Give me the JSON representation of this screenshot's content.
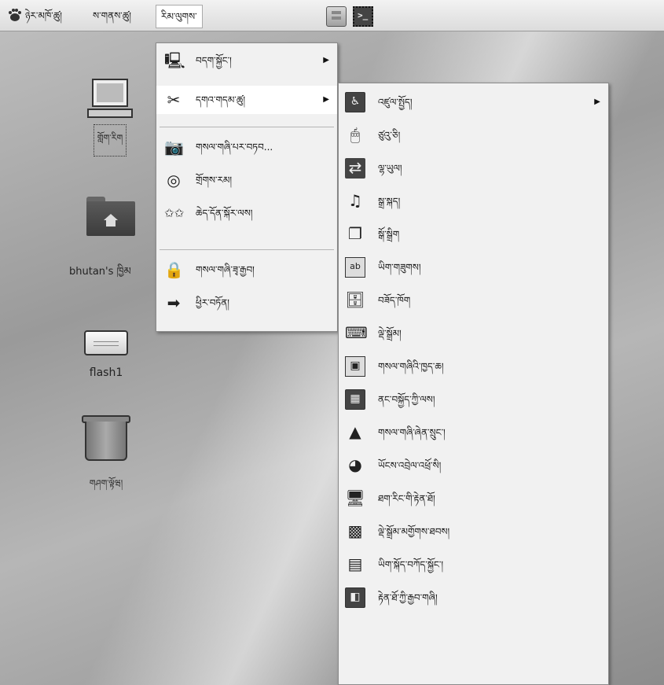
{
  "panel": {
    "applications": "ཉེར་མཁོ་ཚུ།",
    "places": "ས་གནས་ཚུ།",
    "system": "རིམ་ལུགས་",
    "icons": {
      "logo": "gnome-foot-icon",
      "files": "filing-cabinet-icon",
      "terminal": "terminal-icon"
    },
    "terminal_glyph": ">_"
  },
  "desktop": {
    "computer_label": "གློག་རིག",
    "home_label": "bhutan's ཁྱིམ",
    "flash_label": "flash1",
    "trash_label": "གཤག་ལྟོཝ།"
  },
  "system_menu": {
    "items": [
      {
        "label": "བདག་སྐྱོང་།",
        "icon": "computer-icon",
        "has_submenu": true
      },
      {
        "label": "དགའ་གདམ་ཚུ།",
        "icon": "tools-icon",
        "has_submenu": true
      },
      {
        "label": "གསལ་གཞི་པར་བཏབ...",
        "icon": "camera-icon",
        "has_submenu": false
      },
      {
        "label": "གྲོགས་རམ།",
        "icon": "help-icon",
        "has_submenu": false
      },
      {
        "label": "ཆེད་དོན་སྐོར་ལས།",
        "icon": "about-icon",
        "has_submenu": false
      },
      {
        "label": "གསལ་གཞི་ཟྭ་རྒྱབ།",
        "icon": "lock-icon",
        "has_submenu": false
      },
      {
        "label": "ཕྱིར་བཏོན།",
        "icon": "logout-icon",
        "has_submenu": false
      }
    ]
  },
  "preferences_menu": {
    "items": [
      {
        "label": "འཛུལ་སྤྱོད།",
        "icon": "accessibility-icon",
        "has_submenu": true
      },
      {
        "label": "ཙུའུ་ཅི།",
        "icon": "mouse-icon"
      },
      {
        "label": "ལྷ་ཡུལ།",
        "icon": "network-icon"
      },
      {
        "label": "སྒྲ་སྐད།",
        "icon": "sound-icon"
      },
      {
        "label": "སྒོ་སྒྲིག",
        "icon": "windows-icon"
      },
      {
        "label": "ཡིག་གཟུགས།",
        "icon": "font-icon"
      },
      {
        "label": "བཟོད་ཁོག",
        "icon": "file-management-icon"
      },
      {
        "label": "ལྡེ་སྒྲོམ།",
        "icon": "keyboard-icon"
      },
      {
        "label": "གསལ་གཞིའི་ཁྱད་ཆ།",
        "icon": "screen-resolution-icon"
      },
      {
        "label": "ནང་བསྐྱོད་ཀྱི་ལས།",
        "icon": "desktop-background-icon"
      },
      {
        "label": "གསལ་གཞི་ཞེན་སྲུང་།",
        "icon": "screensaver-icon"
      },
      {
        "label": "ཡོངས་འབྲེལ་འཕྲོ་སི།",
        "icon": "network-proxy-icon"
      },
      {
        "label": "ཐག་རིང་གི་རྟེན་ཐོ།",
        "icon": "remote-desktop-icon"
      },
      {
        "label": "ལྡེ་སྒྲོམ་མགྱོགས་ཐབས།",
        "icon": "keyboard-shortcuts-icon"
      },
      {
        "label": "ཡིག་སྐོད་བཀོད་སྐྱོང་།",
        "icon": "file-manager-icon"
      },
      {
        "label": "རྟེན་ཐོ་ཀྱི་རྒྱབ་གཞི།",
        "icon": "theme-icon"
      }
    ]
  }
}
